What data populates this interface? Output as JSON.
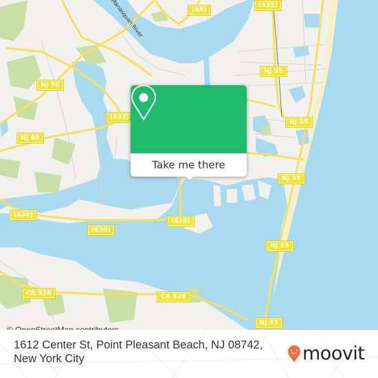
{
  "map": {
    "colors": {
      "land": "#f2f1ee",
      "water": "#aadaef",
      "park": "#c8e0a8",
      "road": "#f5e15c",
      "beach": "#f7f0c8"
    },
    "water_labels": [
      {
        "name": "manasquan-river-label",
        "text": "Manasquan River"
      }
    ],
    "road_shields": [
      {
        "id": "cr48",
        "text": "(48)"
      },
      {
        "id": "cr635",
        "text": "(635)"
      },
      {
        "id": "nj70",
        "text": "NJ 70"
      },
      {
        "id": "cr632",
        "text": "(632)"
      },
      {
        "id": "nj88",
        "text": "NJ 88"
      },
      {
        "id": "nj35-a",
        "text": "NJ 35"
      },
      {
        "id": "nj35-b",
        "text": "NJ 35"
      },
      {
        "id": "nj35-c",
        "text": "NJ 35"
      },
      {
        "id": "nj35-d",
        "text": "NJ 35"
      },
      {
        "id": "nj35-e",
        "text": "NJ 35"
      },
      {
        "id": "cr630-a",
        "text": "(630)"
      },
      {
        "id": "cr630-b",
        "text": "(630)"
      },
      {
        "id": "cr630-c",
        "text": "(630)"
      },
      {
        "id": "cr528-a",
        "text": "CR 528"
      },
      {
        "id": "cr528-b",
        "text": "CR 528"
      }
    ],
    "attribution": "© OpenStreetMap contributors"
  },
  "popup": {
    "icon": "map-pin-icon",
    "accent_color": "#1fba6b",
    "button_label": "Take me there"
  },
  "footer": {
    "address_line1": "1612 Center St, Point Pleasant Beach, NJ 08742,",
    "address_line2": "New York City",
    "logo_text": "moovit",
    "logo_icon": "moovit-pin-icon",
    "logo_color": "#f26b3a"
  }
}
